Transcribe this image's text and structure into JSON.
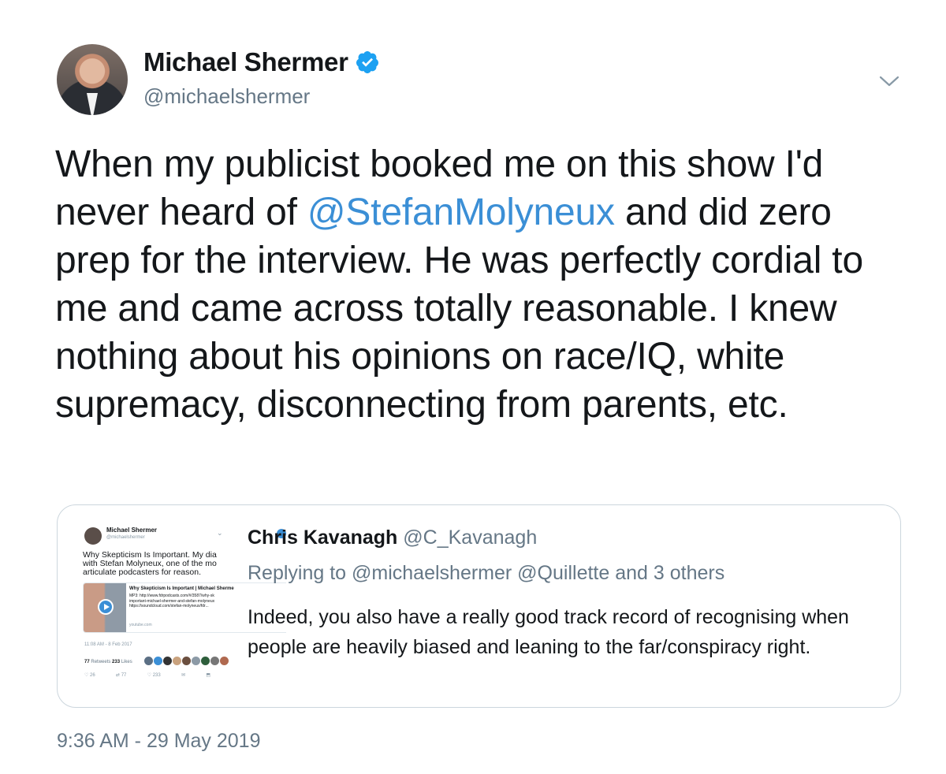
{
  "author": {
    "name": "Michael Shermer",
    "handle": "@michaelshermer",
    "verified": true
  },
  "icons": {
    "verified": "verified-badge-icon",
    "menu": "chevron-down-icon",
    "play": "play-icon"
  },
  "tweet": {
    "text_before_mention": "When my publicist booked me on this show I'd never heard of ",
    "mention": "@StefanMolyneux",
    "text_after_mention": " and did zero prep for the interview. He was perfectly cordial to me and came across totally reasonable. I knew nothing about his opinions on race/IQ, white supremacy, disconnecting from parents, etc.",
    "timestamp": "9:36 AM - 29 May 2019"
  },
  "quoted_tweet": {
    "name": "Chris Kavanagh",
    "handle": "@C_Kavanagh",
    "replying_to": "Replying to @michaelshermer @Quillette and 3 others",
    "text": "Indeed, you also have a really good track record of recognising when people are heavily biased and leaning to the far/conspiracy right.",
    "thumbnail": {
      "name": "Michael Shermer",
      "handle": "@michaelshermer",
      "text_lines": [
        "Why Skepticism Is Important. My dia",
        "with Stefan Molyneux, one of the mo",
        "articulate podcasters for reason."
      ],
      "card_title": "Why Skepticism Is Important | Michael Sherme",
      "card_desc": "MP3: http://www.fdrpodcasts.com/#/3587/why-sk\nimportant-michael-shermer-and-stefan-molyneux\nhttps://soundcloud.com/stefan-molyneux/fdr...",
      "card_url": "youtube.com",
      "time": "11:08 AM - 8 Feb 2017",
      "retweets": "77",
      "retweets_label": "Retweets",
      "likes": "233",
      "likes_label": "Likes",
      "actions": [
        "♡ 26",
        "⇄ 77",
        "♡ 233",
        "✉",
        "⬒"
      ]
    }
  },
  "colors": {
    "text": "#14171a",
    "secondary": "#657786",
    "link": "#3b8fd6",
    "border": "#ccd6dd"
  }
}
